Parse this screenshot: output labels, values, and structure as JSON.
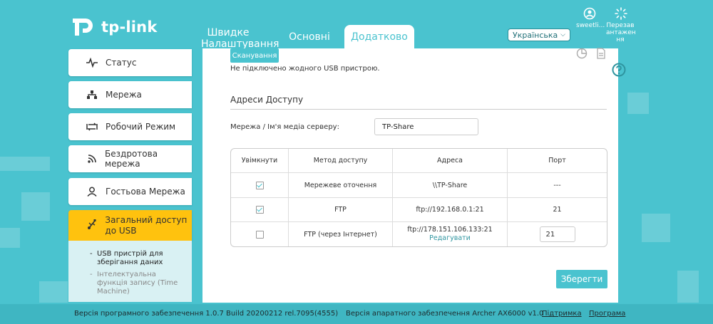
{
  "header": {
    "logo_text": "tp-link",
    "tabs": [
      {
        "label": "Швидке Налаштування"
      },
      {
        "label": "Основні"
      },
      {
        "label": "Додатково"
      }
    ],
    "language": "Українська",
    "user_label": "sweetli...",
    "reboot_label": "Перезав антажен ня"
  },
  "sidebar": {
    "items": [
      {
        "label": "Статус",
        "icon": "pulse-icon"
      },
      {
        "label": "Мережа",
        "icon": "network-icon"
      },
      {
        "label": "Робочий Режим",
        "icon": "mode-icon"
      },
      {
        "label": "Бездротова мережа",
        "icon": "wifi-icon"
      },
      {
        "label": "Гостьова Мережа",
        "icon": "guest-icon"
      },
      {
        "label": "Загальний доступ до USB",
        "icon": "usb-icon"
      }
    ],
    "subitems": [
      {
        "label": "USB пристрій для зберігання даних"
      },
      {
        "label": "Інтелектуальна функція запису (Time Machine)"
      }
    ]
  },
  "main": {
    "scan_button": "Сканування",
    "no_usb_text": "Не підключено жодного USB пристрою.",
    "section_title": "Адреси Доступу",
    "server_label": "Мережа / Ім'я медіа серверу:",
    "server_value": "TP-Share",
    "table": {
      "headers": [
        "Увімкнути",
        "Метод доступу",
        "Адреса",
        "Порт"
      ],
      "rows": [
        {
          "enabled": true,
          "method": "Мережеве оточення",
          "address": "\\\\TP-Share",
          "port": "---"
        },
        {
          "enabled": true,
          "method": "FTP",
          "address": "ftp://192.168.0.1:21",
          "port": "21"
        },
        {
          "enabled": false,
          "method": "FTP (через Інтернет)",
          "address": "ftp://178.151.106.133:21",
          "edit": "Редагувати",
          "port": "21"
        }
      ]
    },
    "save_button": "Зберегти"
  },
  "footer": {
    "firmware": "Версія програмного забезпечення 1.0.7 Build 20200212 rel.7095(4555)",
    "hardware": "Версія апаратного забезпечення Archer AX6000 v1.0",
    "support": "Підтримка",
    "app": "Програма"
  },
  "colors": {
    "accent": "#4ac3cf",
    "active": "#ffc20e"
  }
}
